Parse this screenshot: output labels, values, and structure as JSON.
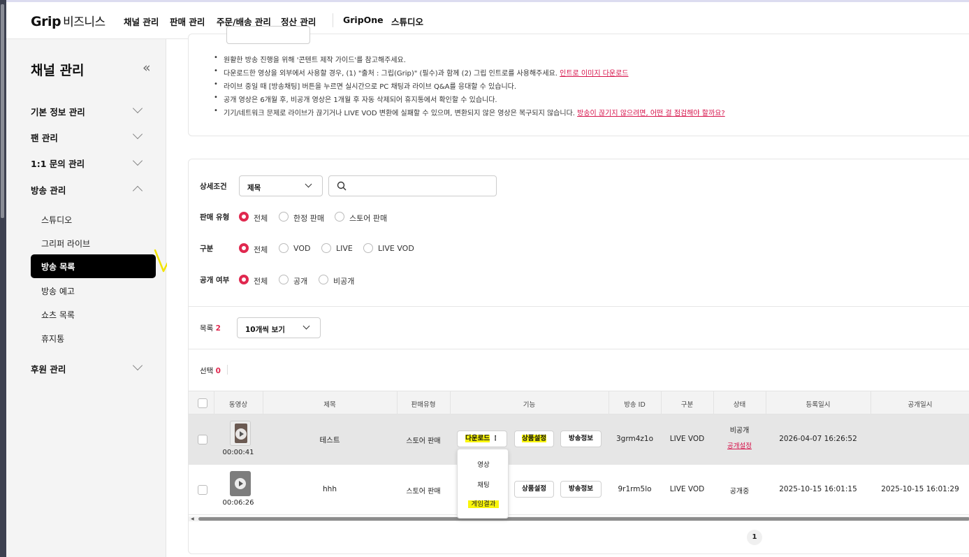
{
  "brand": {
    "logo": "Grip",
    "logo_sub": "비즈니스"
  },
  "topnav": [
    "채널 관리",
    "판매 관리",
    "주문/배송 관리",
    "정산 관리",
    "GripOne",
    "스튜디오"
  ],
  "sidebar": {
    "title": "채널 관리",
    "collapse_icon": "«",
    "groups": [
      "기본 정보 관리",
      "팬 관리",
      "1:1 문의 관리",
      "방송 관리",
      "후원 관리"
    ],
    "items": [
      "스튜디오",
      "그리퍼 라이브",
      "방송 목록",
      "방송 예고",
      "쇼츠 목록",
      "휴지통"
    ],
    "active_item": "방송 목록"
  },
  "guide": {
    "button_label": "",
    "notes": [
      {
        "text": "원활한 방송 진행을 위해 '콘텐트 제작 가이드'를 참고해주세요.",
        "link": ""
      },
      {
        "text": "다운로드한 영상을 외부에서 사용할 경우, (1) \"출처 : 그립(Grip)\" (필수)과 함께 (2) 그립 인트로를 사용해주세요.",
        "link": "인트로 이미지 다운로드"
      },
      {
        "text": "라이브 중일 때 [방송채팅] 버튼을 누르면 실시간으로 PC 채팅과 라이브 Q&A를 응대할 수 있습니다.",
        "link": ""
      },
      {
        "text": "공개 영상은 6개월 후, 비공개 영상은 1개월 후 자동 삭제되어 휴지통에서 확인할 수 있습니다.",
        "link": ""
      },
      {
        "text": "기기/네트워크 문제로 라이브가 끊기거나 LIVE VOD 변환에 실패할 수 있으며, 변환되지 않은 영상은 복구되지 않습니다.",
        "link": "방송이 끊기지 않으려면, 어떤 걸 점검해야 할까요?"
      }
    ]
  },
  "filters": {
    "detail_label": "상세조건",
    "detail_select": "제목",
    "search_placeholder": "",
    "sale_type_label": "판매 유형",
    "sale_type_options": [
      "전체",
      "한정 판매",
      "스토어 판매"
    ],
    "category_label": "구분",
    "category_options": [
      "전체",
      "VOD",
      "LIVE",
      "LIVE VOD"
    ],
    "visibility_label": "공개 여부",
    "visibility_options": [
      "전체",
      "공개",
      "비공개"
    ],
    "selected": "전체"
  },
  "list": {
    "count_label": "목록",
    "count": "2",
    "page_size": "10개씩 보기",
    "selected_label": "선택",
    "selected_count": "0"
  },
  "table": {
    "headers": [
      "동영상",
      "제목",
      "판매유형",
      "기능",
      "방송 ID",
      "구분",
      "상태",
      "등록일시",
      "공개일시"
    ],
    "rows": [
      {
        "duration": "00:00:41",
        "title": "테스트",
        "sale_type": "스토어 판매",
        "download": "다운로드",
        "product_btn": "상품설정",
        "info_btn": "방송정보",
        "broadcast_id": "3grm4z1o",
        "category": "LIVE VOD",
        "status": "비공개",
        "status_link": "공개설정",
        "registered": "2026-04-07 16:26:52",
        "published": ""
      },
      {
        "duration": "00:06:26",
        "title": "hhh",
        "sale_type": "스토어 판매",
        "download": "",
        "product_btn": "상품설정",
        "info_btn": "방송정보",
        "broadcast_id": "9r1rm5lo",
        "category": "LIVE VOD",
        "status": "공개중",
        "status_link": "",
        "registered": "2025-10-15 16:01:15",
        "published": "2025-10-15 16:01:29"
      }
    ],
    "download_menu": [
      "영상",
      "채팅",
      "게임결과"
    ]
  },
  "pagination": {
    "current": "1"
  },
  "colors": {
    "accent": "#e0284f",
    "highlight": "#f9f50a",
    "active_bg": "#000000"
  }
}
